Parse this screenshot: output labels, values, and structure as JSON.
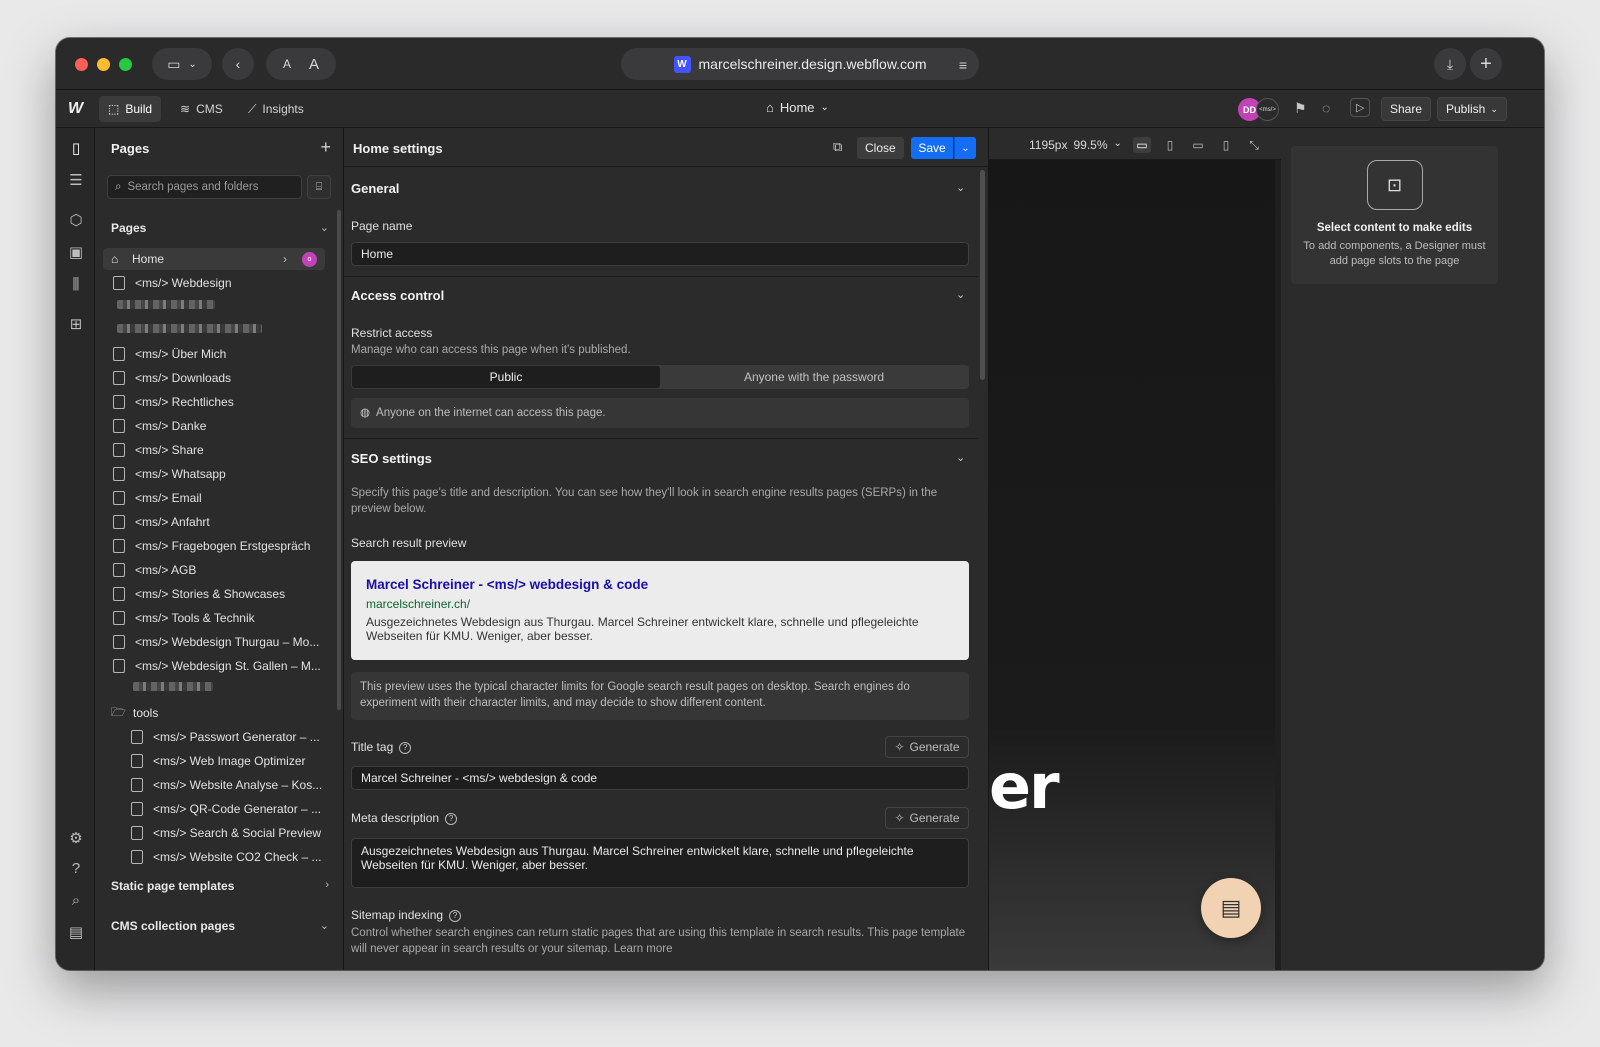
{
  "browser": {
    "url": "marcelschreiner.design.webflow.com",
    "font_small_label": "A",
    "font_large_label": "A"
  },
  "toolbar": {
    "tabs": [
      {
        "label": "Build",
        "icon": "build-icon"
      },
      {
        "label": "CMS",
        "icon": "database-icon"
      },
      {
        "label": "Insights",
        "icon": "chart-icon"
      }
    ],
    "current_page": "Home",
    "avatar_initials": "DD",
    "avatar2_label": "<ms/>",
    "share_label": "Share",
    "publish_label": "Publish"
  },
  "pages_panel": {
    "title": "Pages",
    "search_placeholder": "Search pages and folders",
    "section_pages": "Pages",
    "home_label": "Home",
    "home_badge": "o",
    "items": [
      "<ms/> Webdesign",
      "<ms/> Über Mich",
      "<ms/> Downloads",
      "<ms/> Rechtliches",
      "<ms/> Danke",
      "<ms/> Share",
      "<ms/> Whatsapp",
      "<ms/> Email",
      "<ms/> Anfahrt",
      "<ms/> Fragebogen Erstgespräch",
      "<ms/> AGB",
      "<ms/> Stories & Showcases",
      "<ms/> Tools & Technik",
      "<ms/> Webdesign Thurgau – Mo...",
      "<ms/> Webdesign St. Gallen – M..."
    ],
    "folder_label": "tools",
    "folder_items": [
      "<ms/> Passwort Generator – ...",
      "<ms/> Web Image Optimizer",
      "<ms/> Website Analyse – Kos...",
      "<ms/> QR-Code Generator – ...",
      "<ms/> Search & Social Preview",
      "<ms/> Website CO2 Check – ..."
    ],
    "static_templates": "Static page templates",
    "cms_pages": "CMS collection pages"
  },
  "settings": {
    "title": "Home settings",
    "close_label": "Close",
    "save_label": "Save",
    "general": {
      "title": "General",
      "page_name_label": "Page name",
      "page_name_value": "Home"
    },
    "access": {
      "title": "Access control",
      "restrict_label": "Restrict access",
      "restrict_sub": "Manage who can access this page when it's published.",
      "opt_public": "Public",
      "opt_password": "Anyone with the password",
      "info": "Anyone on the internet can access this page."
    },
    "seo": {
      "title": "SEO settings",
      "description": "Specify this page's title and description. You can see how they'll look in search engine results pages (SERPs) in the preview below.",
      "preview_label": "Search result preview",
      "serp_title": "Marcel Schreiner - <ms/> webdesign & code",
      "serp_url": "marcelschreiner.ch/",
      "serp_desc": "Ausgezeichnetes Webdesign aus Thurgau. Marcel Schreiner entwickelt klare, schnelle und pflegeleichte Webseiten für KMU. Weniger, aber besser.",
      "preview_note": "This preview uses the typical character limits for Google search result pages on desktop. Search engines do experiment with their character limits, and may decide to show different content.",
      "title_tag_label": "Title tag",
      "title_tag_value": "Marcel Schreiner - <ms/> webdesign & code",
      "generate_label": "Generate",
      "meta_label": "Meta description",
      "meta_value": "Ausgezeichnetes Webdesign aus Thurgau. Marcel Schreiner entwickelt klare, schnelle und pflegeleichte Webseiten für KMU. Weniger, aber besser.",
      "sitemap_label": "Sitemap indexing",
      "sitemap_desc": "Control whether search engines can return static pages that are using this template in search results. This page template will never appear in search results or your sitemap. Learn more"
    }
  },
  "canvas": {
    "width_label": "1195px",
    "zoom_label": "99.5%",
    "hero_fragment": "er"
  },
  "right_panel": {
    "title": "Select content to make edits",
    "text": "To add components, a Designer must add page slots to the page"
  },
  "colors": {
    "accent": "#146ef5",
    "avatar": "#c243b5",
    "serp_link": "#1a0dab",
    "serp_url": "#0d652d"
  }
}
